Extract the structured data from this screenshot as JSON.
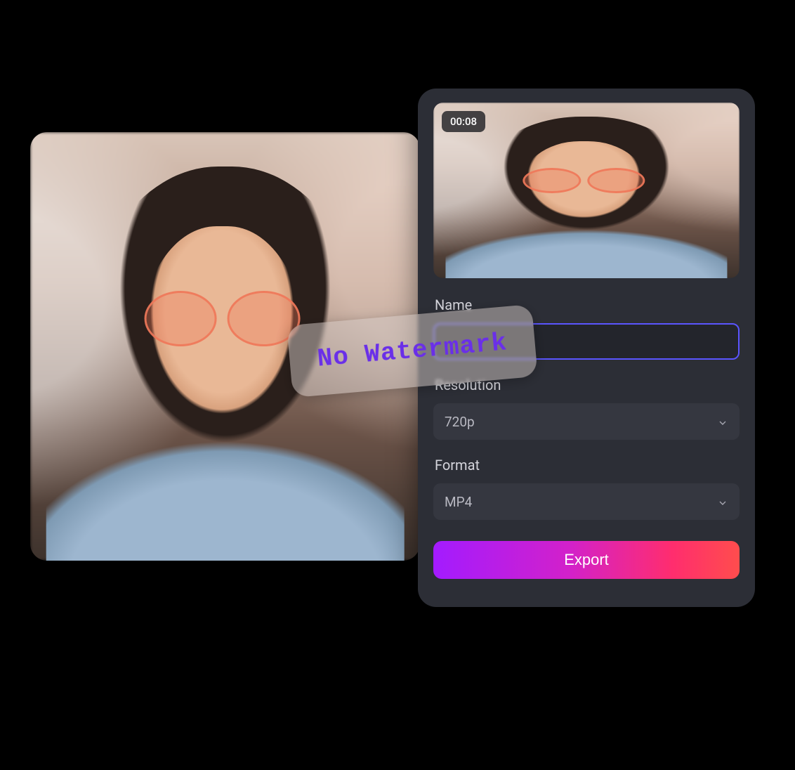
{
  "preview": {
    "timestamp": "00:08"
  },
  "watermark": {
    "text": "No Watermark"
  },
  "export": {
    "name_label": "Name",
    "name_value": "",
    "resolution_label": "Resolution",
    "resolution_value": "720p",
    "format_label": "Format",
    "format_value": "MP4",
    "button_label": "Export"
  },
  "colors": {
    "panel_bg": "#2c2e36",
    "input_border_active": "#5a55ff",
    "gradient_start": "#a31bff",
    "gradient_end": "#ff4d4d"
  }
}
